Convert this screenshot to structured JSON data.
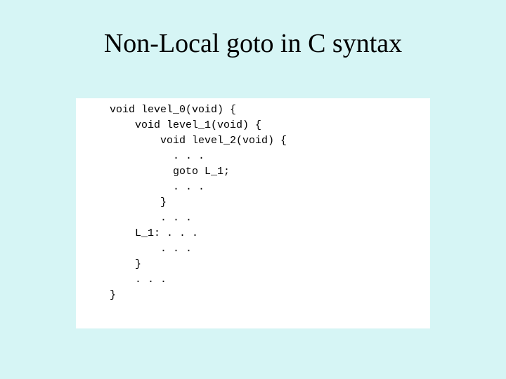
{
  "title": "Non-Local goto in C syntax",
  "code": {
    "l1": "void level_0(void) {",
    "l2": "",
    "l3": "    void level_1(void) {",
    "l4": "",
    "l5": "        void level_2(void) {",
    "l6": "",
    "l7": "          . . .",
    "l8": "          goto L_1;",
    "l9": "          . . .",
    "l10": "        }",
    "l11": "        . . .",
    "l12": "    L_1: . . .",
    "l13": "        . . .",
    "l14": "    }",
    "l15": "    . . .",
    "l16": "}"
  }
}
